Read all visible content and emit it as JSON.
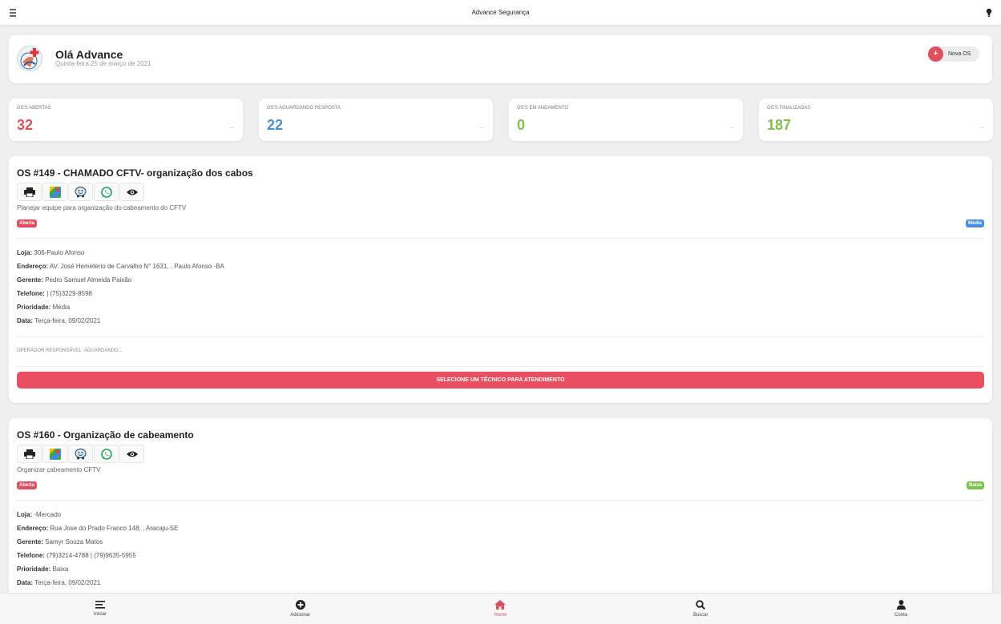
{
  "app": {
    "title": "Advance Segurança"
  },
  "welcome": {
    "greeting": "Olá Advance",
    "date": "Quinta-feira 25 de março de 2021",
    "new_os_label": "Nova OS"
  },
  "stats": [
    {
      "label": "OS'S ABERTAS",
      "value": "32",
      "color": "#e04e5f"
    },
    {
      "label": "OS'S AGUARDANDO RESPOSTA",
      "value": "22",
      "color": "#4a8fd9"
    },
    {
      "label": "OS'S EM ANDAMENTO",
      "value": "0",
      "color": "#7dc24f"
    },
    {
      "label": "OS'S FINALIZADAS",
      "value": "187",
      "color": "#7dc24f"
    }
  ],
  "orders": [
    {
      "title": "OS #149 - CHAMADO CFTV- organização dos cabos",
      "description": "Planejar equipe para organização do cabeamento do CFTV",
      "status": "Aberta",
      "priority_badge": "Média",
      "priority_color": "#4a8fd9",
      "fields": [
        {
          "label": "Loja:",
          "value": " 306-Paulo Afonso"
        },
        {
          "label": "Endereço:",
          "value": " AV. José Hemeterio de Carvalho N° 1631, , Paulo Afonso -BA"
        },
        {
          "label": "Gerente:",
          "value": " Pedro Samuel Almeida Paixão"
        },
        {
          "label": "Telefone:",
          "value": " | (75)3229-8598"
        },
        {
          "label": "Prioridade:",
          "value": " Média"
        },
        {
          "label": "Data:",
          "value": " Terça-feira, 09/02/2021"
        }
      ],
      "operator": "OPERADOR RESPONSÁVEL: AGUARDANDO...",
      "select_label": "SELECIONE UM TÉCNICO PARA ATENDIMENTO"
    },
    {
      "title": "OS #160 - Organização de cabeamento",
      "description": "Organizar cabeamento CFTV",
      "status": "Aberta",
      "priority_badge": "Baixa",
      "priority_color": "#7dc24f",
      "fields": [
        {
          "label": "Loja:",
          "value": " -Mercado"
        },
        {
          "label": "Endereço:",
          "value": " Rua Jose do Prado Franco 148, , Aracaju-SE"
        },
        {
          "label": "Gerente:",
          "value": " Samyr Souza Matos"
        },
        {
          "label": "Telefone:",
          "value": " (79)3214-4788 | (79)9635-5955"
        },
        {
          "label": "Prioridade:",
          "value": " Baixa"
        },
        {
          "label": "Data:",
          "value": " Terça-feira, 09/02/2021"
        }
      ]
    }
  ],
  "icons": [
    "print-icon",
    "maps-icon",
    "waze-icon",
    "whatsapp-icon",
    "eye-icon"
  ],
  "nav": [
    {
      "label": "Iniciar",
      "icon": "list-icon"
    },
    {
      "label": "Adicionar",
      "icon": "plus-circle-icon"
    },
    {
      "label": "Home",
      "icon": "home-icon"
    },
    {
      "label": "Buscar",
      "icon": "search-icon"
    },
    {
      "label": "Conta",
      "icon": "user-icon"
    }
  ],
  "colors": {
    "accent": "#e04e5f",
    "blue": "#4a8fd9",
    "green": "#7dc24f"
  }
}
